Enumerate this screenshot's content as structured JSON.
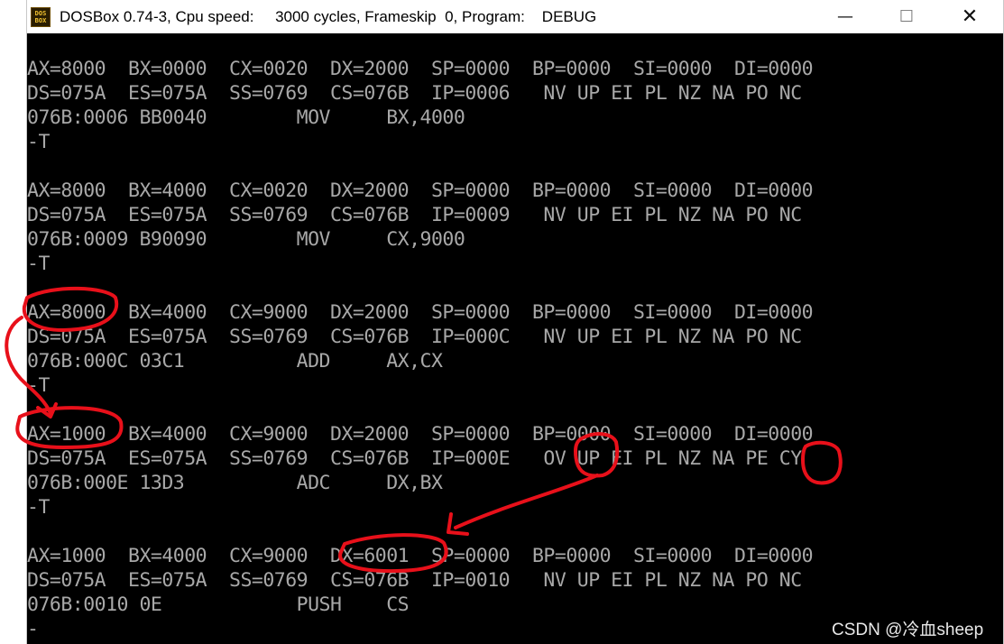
{
  "window": {
    "title": "DOSBox 0.74-3, Cpu speed:     3000 cycles, Frameskip  0, Program:    DEBUG",
    "icon_text_top": "DOS",
    "icon_text_bottom": "BOX",
    "controls": {
      "minimize": "—",
      "maximize": "☐",
      "close": "✕"
    }
  },
  "terminal": {
    "lines": [
      "AX=8000  BX=0000  CX=0020  DX=2000  SP=0000  BP=0000  SI=0000  DI=0000",
      "DS=075A  ES=075A  SS=0769  CS=076B  IP=0006   NV UP EI PL NZ NA PO NC",
      "076B:0006 BB0040        MOV     BX,4000",
      "-T",
      "",
      "AX=8000  BX=4000  CX=0020  DX=2000  SP=0000  BP=0000  SI=0000  DI=0000",
      "DS=075A  ES=075A  SS=0769  CS=076B  IP=0009   NV UP EI PL NZ NA PO NC",
      "076B:0009 B90090        MOV     CX,9000",
      "-T",
      "",
      "AX=8000  BX=4000  CX=9000  DX=2000  SP=0000  BP=0000  SI=0000  DI=0000",
      "DS=075A  ES=075A  SS=0769  CS=076B  IP=000C   NV UP EI PL NZ NA PO NC",
      "076B:000C 03C1          ADD     AX,CX",
      "-T",
      "",
      "AX=1000  BX=4000  CX=9000  DX=2000  SP=0000  BP=0000  SI=0000  DI=0000",
      "DS=075A  ES=075A  SS=0769  CS=076B  IP=000E   OV UP EI PL NZ NA PE CY",
      "076B:000E 13D3          ADC     DX,BX",
      "-T",
      "",
      "AX=1000  BX=4000  CX=9000  DX=6001  SP=0000  BP=0000  SI=0000  DI=0000",
      "DS=075A  ES=075A  SS=0769  CS=076B  IP=0010   NV UP EI PL NZ NA PO NC",
      "076B:0010 0E            PUSH    CS",
      "-"
    ]
  },
  "watermark": "CSDN @冷血sheep",
  "colors": {
    "terminal_bg": "#000000",
    "terminal_text": "#a8a8a8",
    "annotation_red": "#e8101a",
    "titlebar_bg": "#ffffff"
  }
}
